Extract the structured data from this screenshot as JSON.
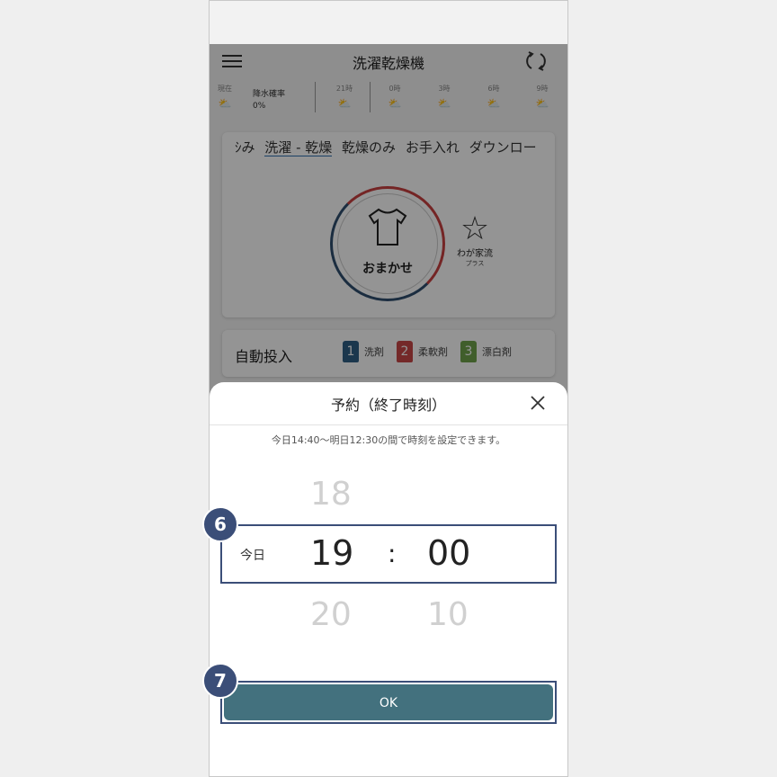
{
  "app": {
    "title": "洗濯乾燥機",
    "weather": {
      "now_label": "現在",
      "rain_label": "降水確率",
      "rain_value": "0%",
      "times": [
        "21時",
        "0時",
        "3時",
        "6時",
        "9時"
      ]
    },
    "course_tabs": [
      "ｼみ",
      "洗濯 - 乾燥",
      "乾燥のみ",
      "お手入れ",
      "ダウンロード"
    ],
    "course_selected": "おまかせ",
    "star_course": {
      "label": "わが家流",
      "sub": "プラス"
    },
    "auto_dose": {
      "label": "自動投入",
      "items": [
        {
          "num": "1",
          "label": "洗剤",
          "color": "#2f5f86"
        },
        {
          "num": "2",
          "label": "柔軟剤",
          "color": "#c94848"
        },
        {
          "num": "3",
          "label": "漂白剤",
          "color": "#6ea24b"
        }
      ]
    }
  },
  "sheet": {
    "title": "予約（終了時刻）",
    "hint": "今日14:40〜明日12:30の間で時刻を設定できます。",
    "picker": {
      "hour_prev": "18",
      "hour": "19",
      "hour_next": "20",
      "minute": "00",
      "minute_next": "10",
      "separator": ":",
      "day": "今日"
    },
    "ok_label": "OK"
  },
  "badges": [
    "6",
    "7"
  ],
  "colors": {
    "accent": "#3b4e78",
    "ok_button": "#43717e"
  }
}
